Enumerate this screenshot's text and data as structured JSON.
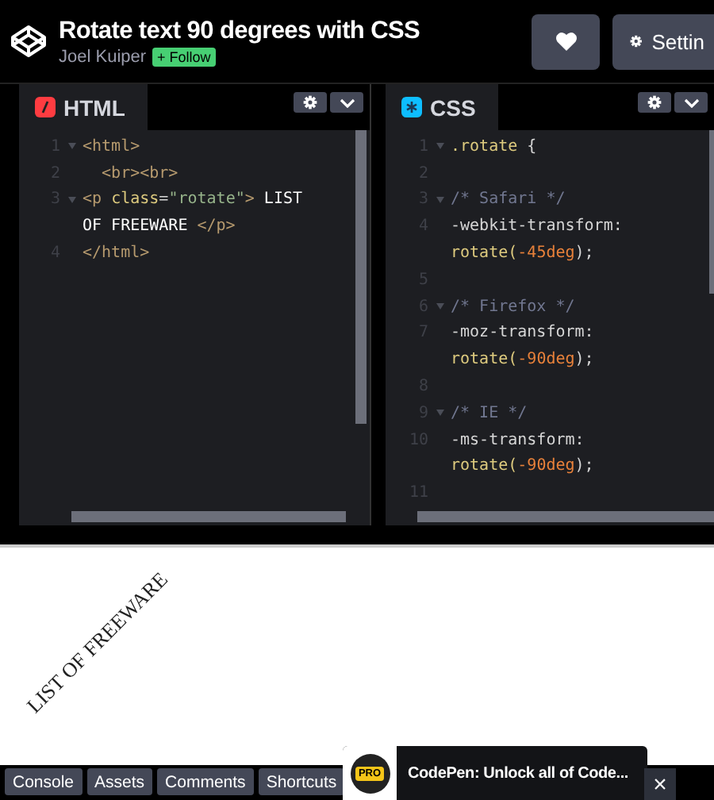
{
  "header": {
    "title": "Rotate text 90 degrees with CSS",
    "author": "Joel Kuiper",
    "follow_label": "+ Follow"
  },
  "header_buttons": [
    {
      "kind": "heart"
    },
    {
      "kind": "settings",
      "label": "Settin"
    }
  ],
  "editors": [
    {
      "kind": "html",
      "title": "HTML",
      "lines": [
        {
          "num": "1",
          "fold": true,
          "tokens": [
            {
              "t": "<html>",
              "kind": "tag"
            }
          ]
        },
        {
          "num": "2",
          "tokens": [
            {
              "t": "  <br><br>",
              "kind": "tag"
            }
          ]
        },
        {
          "num": "3",
          "fold": true,
          "tokens": [
            {
              "t": "<p ",
              "kind": "tag"
            },
            {
              "t": "class",
              "kind": "attr"
            },
            {
              "t": "=",
              "kind": "punct"
            },
            {
              "t": "\"rotate\"",
              "kind": "string"
            },
            {
              "t": ">",
              "kind": "tag"
            },
            {
              "t": " LIST",
              "kind": "text"
            }
          ]
        },
        {
          "tokens": [
            {
              "t": "OF FREEWARE ",
              "kind": "text"
            },
            {
              "t": "</p>",
              "kind": "tag"
            }
          ]
        },
        {
          "num": "4",
          "tokens": [
            {
              "t": "</html>",
              "kind": "tag"
            }
          ]
        }
      ]
    },
    {
      "kind": "css",
      "title": "CSS",
      "lines": [
        {
          "num": "1",
          "fold": true,
          "tokens": [
            {
              "t": ".rotate",
              "kind": "selector"
            },
            {
              "t": " {",
              "kind": "punct"
            }
          ]
        },
        {
          "num": "2"
        },
        {
          "num": "3",
          "fold": true,
          "tokens": [
            {
              "t": "/* Safari */",
              "kind": "comment"
            }
          ]
        },
        {
          "num": "4",
          "tokens": [
            {
              "t": "-webkit-transform:",
              "kind": "prop"
            }
          ]
        },
        {
          "tokens": [
            {
              "t": "rotate(",
              "kind": "func"
            },
            {
              "t": "-45deg",
              "kind": "number"
            },
            {
              "t": ");",
              "kind": "punct"
            }
          ]
        },
        {
          "num": "5"
        },
        {
          "num": "6",
          "fold": true,
          "tokens": [
            {
              "t": "/* Firefox */",
              "kind": "comment"
            }
          ]
        },
        {
          "num": "7",
          "tokens": [
            {
              "t": "-moz-transform:",
              "kind": "prop"
            }
          ]
        },
        {
          "tokens": [
            {
              "t": "rotate(",
              "kind": "func"
            },
            {
              "t": "-90deg",
              "kind": "number"
            },
            {
              "t": ");",
              "kind": "punct"
            }
          ]
        },
        {
          "num": "8"
        },
        {
          "num": "9",
          "fold": true,
          "tokens": [
            {
              "t": "/* IE */",
              "kind": "comment"
            }
          ]
        },
        {
          "num": "10",
          "tokens": [
            {
              "t": "-ms-transform:",
              "kind": "prop"
            }
          ]
        },
        {
          "tokens": [
            {
              "t": "rotate(",
              "kind": "func"
            },
            {
              "t": "-90deg",
              "kind": "number"
            },
            {
              "t": ");",
              "kind": "punct"
            }
          ]
        },
        {
          "num": "11"
        }
      ]
    }
  ],
  "preview": {
    "text": "LIST OF FREEWARE"
  },
  "footer_tabs": [
    "Console",
    "Assets",
    "Comments",
    "Shortcuts"
  ],
  "toast": {
    "badge": "PRO",
    "message": "CodePen: Unlock all of Code...",
    "close": "×"
  }
}
